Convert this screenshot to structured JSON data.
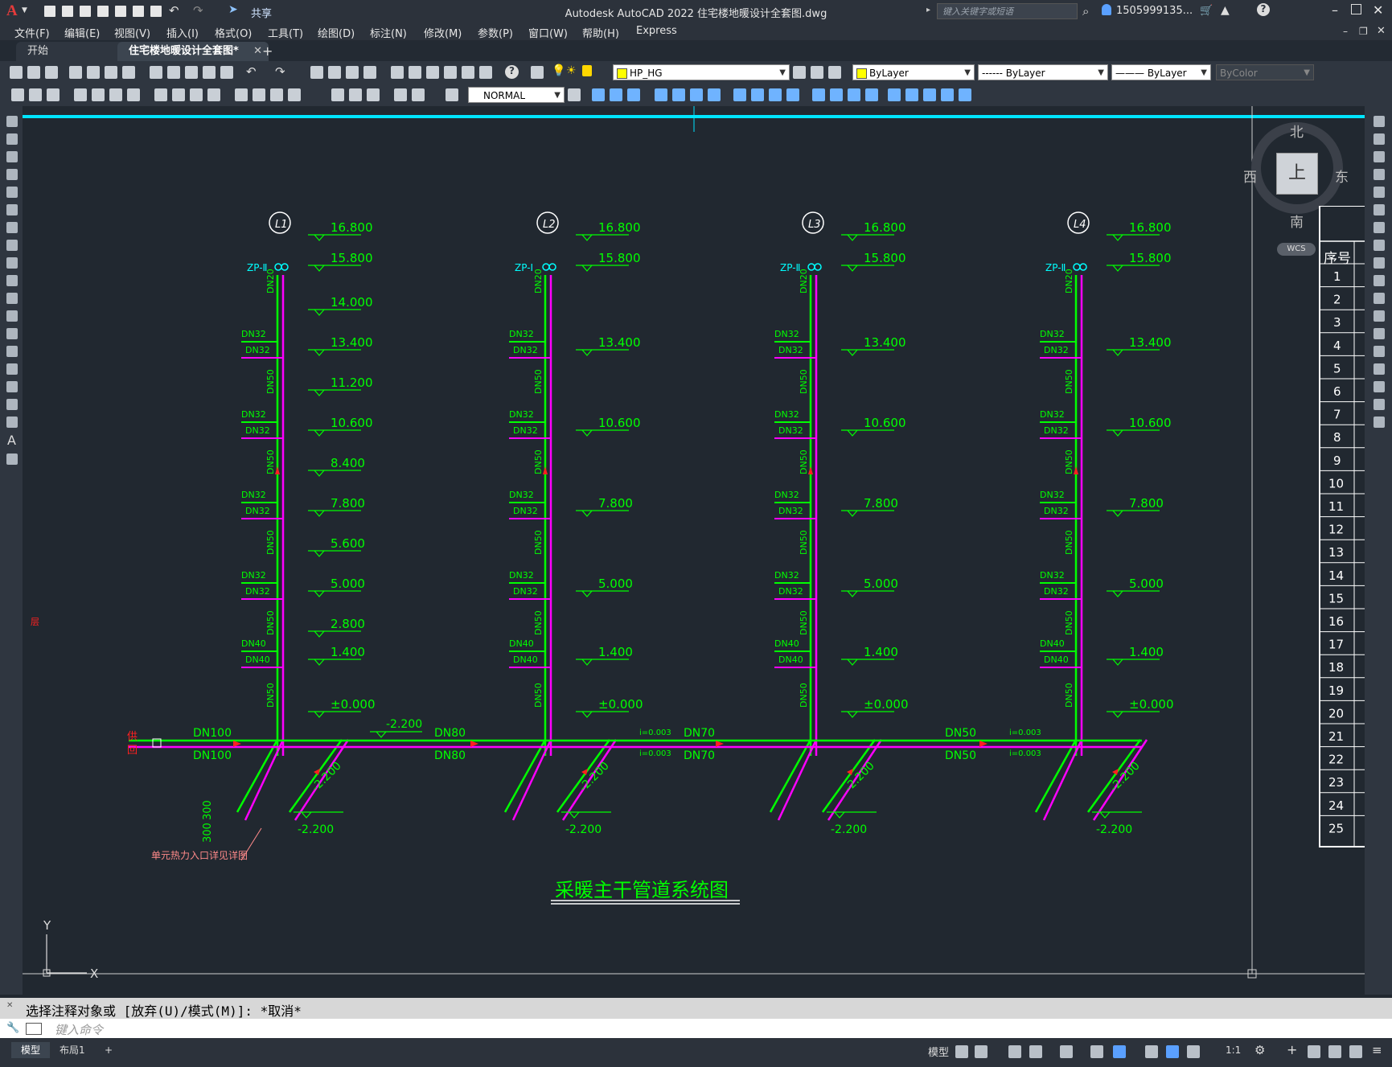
{
  "app": {
    "title": "Autodesk AutoCAD 2022    住宅楼地暖设计全套图.dwg",
    "share_label": "共享",
    "search_placeholder": "键入关键字或短语",
    "user": "1505999135...",
    "logo": "A"
  },
  "menu": [
    "文件(F)",
    "编辑(E)",
    "视图(V)",
    "插入(I)",
    "格式(O)",
    "工具(T)",
    "绘图(D)",
    "标注(N)",
    "修改(M)",
    "参数(P)",
    "窗口(W)",
    "帮助(H)",
    "Express"
  ],
  "tabs": {
    "start": "开始",
    "active": "住宅楼地暖设计全套图*",
    "add": "+"
  },
  "toolbar": {
    "layer": "HP_HG",
    "color": "ByLayer",
    "linetype": "------ ByLayer",
    "lineweight": "——— ByLayer",
    "plotstyle": "ByColor",
    "textstyle": "NORMAL"
  },
  "viewcube": {
    "north": "北",
    "south": "南",
    "east": "东",
    "west": "西",
    "top": "上",
    "wcs": "WCS"
  },
  "drawing": {
    "title": "采暖主干管道系统图",
    "risers": [
      "L1",
      "L2",
      "L3",
      "L4"
    ],
    "riser_tag": [
      "ZP-Ⅱ",
      "ZP-Ⅰ",
      "ZP-Ⅱ",
      "ZP-Ⅱ"
    ],
    "elev_top": [
      "16.800",
      "15.800"
    ],
    "elev_l1": [
      "14.000",
      "13.400",
      "11.200",
      "10.600",
      "8.400",
      "7.800",
      "5.600",
      "5.000",
      "2.800",
      "1.400",
      "±0.000"
    ],
    "elev_other": [
      "13.400",
      "10.600",
      "7.800",
      "5.000",
      "1.400",
      "±0.000"
    ],
    "branch_labels": [
      "DN32",
      "DN32",
      "DN32",
      "DN32",
      "DN32",
      "DN32",
      "DN32",
      "DN32",
      "DN40",
      "DN40"
    ],
    "riser_dn": [
      "DN20",
      "DN50",
      "DN50",
      "DN50",
      "DN50",
      "DN50"
    ],
    "main_labels": [
      {
        "top": "DN100",
        "bottom": "DN100"
      },
      {
        "top": "DN80",
        "bottom": "DN80"
      },
      {
        "top": "DN70",
        "bottom": "DN70"
      },
      {
        "top": "DN50",
        "bottom": "DN50"
      }
    ],
    "slope": "i=0.003",
    "base_elev": "-2.200",
    "supply_label": "供",
    "return_label": "回",
    "detail_note": "单元热力入口详见详图",
    "dim_300": "300",
    "side_mark": "层",
    "axis_y": "Y",
    "axis_x": "X"
  },
  "table": {
    "header_no": "序号",
    "rows": [
      "1",
      "2",
      "3",
      "4",
      "5",
      "6",
      "7",
      "8",
      "9",
      "10",
      "11",
      "12",
      "13",
      "14",
      "15",
      "16",
      "17",
      "18",
      "19",
      "20",
      "21",
      "22",
      "23",
      "24",
      "25"
    ]
  },
  "command": {
    "history": "选择注释对象或 [放弃(U)/模式(M)]: *取消*",
    "placeholder": "键入命令"
  },
  "status": {
    "model_tab": "模型",
    "layout_tab": "布局1",
    "add": "+",
    "model_label": "模型",
    "scale": "1:1"
  },
  "colors": {
    "green": "#00ff00",
    "magenta": "#ff00ff",
    "cyan": "#00ffff",
    "red": "#ff2020",
    "bg": "#212830"
  }
}
